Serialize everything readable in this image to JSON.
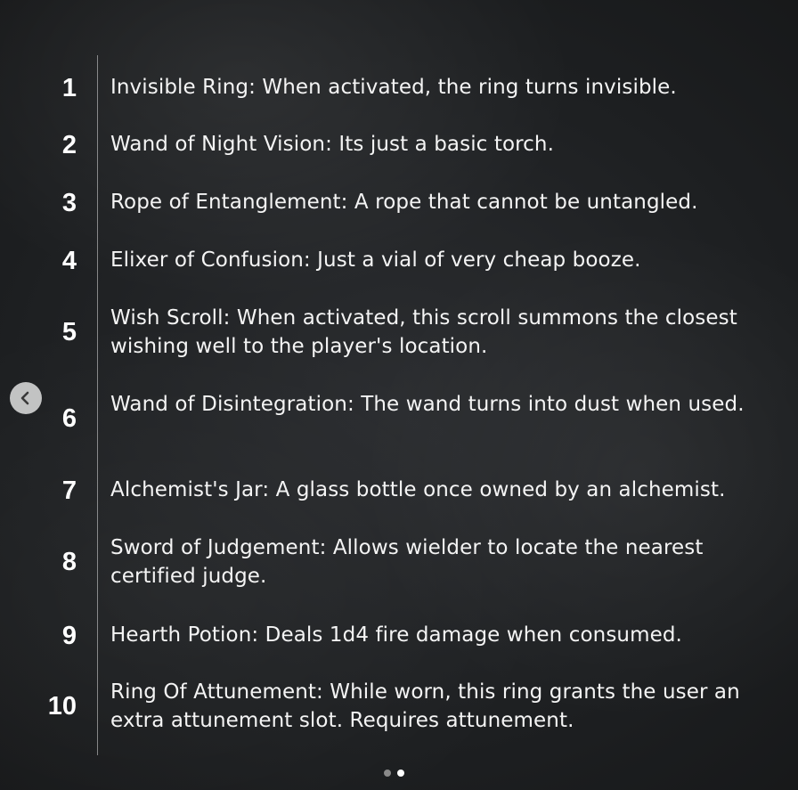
{
  "items": [
    {
      "number": "1",
      "text": "Invisible Ring: When activated, the ring turns invisible."
    },
    {
      "number": "2",
      "text": "Wand of Night Vision: Its just a basic torch."
    },
    {
      "number": "3",
      "text": "Rope of Entanglement: A rope that cannot be untangled."
    },
    {
      "number": "4",
      "text": "Elixer of Confusion: Just a vial of very cheap booze."
    },
    {
      "number": "5",
      "text": "Wish Scroll: When activated, this scroll summons the closest wishing well to the player's location."
    },
    {
      "number": "6",
      "text": "Wand of Disintegration: The wand turns into dust when used."
    },
    {
      "number": "7",
      "text": "Alchemist's Jar: A glass bottle once owned by an alchemist."
    },
    {
      "number": "8",
      "text": "Sword of Judgement: Allows wielder to locate the nearest certified judge."
    },
    {
      "number": "9",
      "text": "Hearth Potion: Deals 1d4 fire damage when consumed."
    },
    {
      "number": "10",
      "text": "Ring Of Attunement: While worn, this ring grants the user an extra attunement slot. Requires attunement."
    }
  ],
  "navigation": {
    "prev_icon": "chevron-left-icon",
    "page_count": 2,
    "current_page": 2
  },
  "colors": {
    "background": "#1d1f21",
    "text": "#f4f4f4",
    "dot_active": "#ffffff",
    "dot_inactive": "#8a8a8a"
  }
}
